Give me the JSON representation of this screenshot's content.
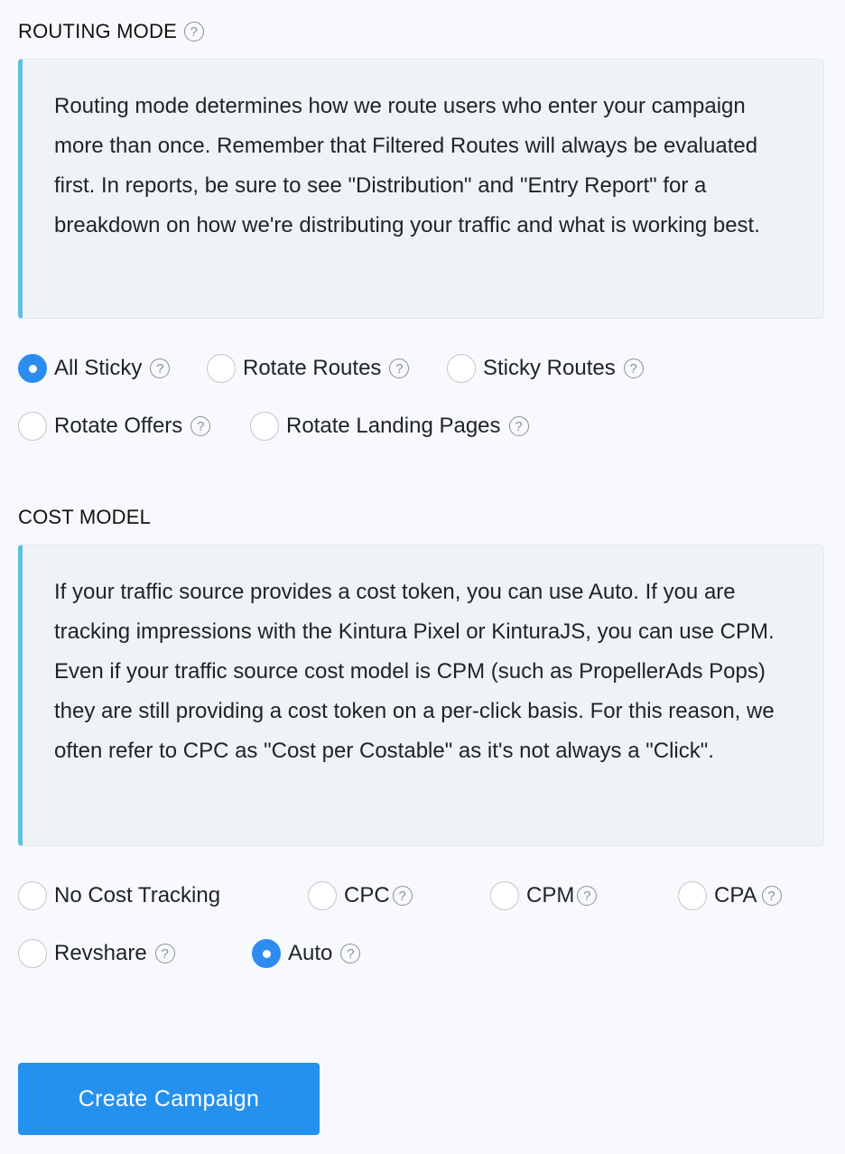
{
  "routing": {
    "title": "ROUTING MODE",
    "help_glyph": "?",
    "description": "Routing mode determines how we route users who enter your campaign more than once. Remember that Filtered Routes will always be evaluated first. In reports, be sure to see \"Distribution\" and \"Entry Report\" for a breakdown on how we're distributing your traffic and what is working best.",
    "options": [
      {
        "label": "All Sticky",
        "checked": true
      },
      {
        "label": "Rotate Routes",
        "checked": false
      },
      {
        "label": "Sticky Routes",
        "checked": false
      },
      {
        "label": "Rotate Offers",
        "checked": false
      },
      {
        "label": "Rotate Landing Pages",
        "checked": false
      }
    ]
  },
  "cost": {
    "title": "COST MODEL",
    "description": "If your traffic source provides a cost token, you can use Auto. If you are tracking impressions with the Kintura Pixel or KinturaJS, you can use CPM. Even if your traffic source cost model is CPM (such as PropellerAds Pops) they are still providing a cost token on a per-click basis. For this reason, we often refer to CPC as \"Cost per Costable\" as it's not always a \"Click\".",
    "options": [
      {
        "label": "No Cost Tracking",
        "checked": false
      },
      {
        "label": "CPC",
        "checked": false
      },
      {
        "label": "CPM",
        "checked": false
      },
      {
        "label": "CPA",
        "checked": false
      },
      {
        "label": "Revshare",
        "checked": false
      },
      {
        "label": "Auto",
        "checked": true
      }
    ]
  },
  "actions": {
    "create_label": "Create Campaign"
  },
  "colors": {
    "accent": "#2d8cf0",
    "button": "#2591ef",
    "callout_border": "#5bc0de",
    "callout_bg": "#eef3f6",
    "page_bg": "#f7f9fd"
  }
}
